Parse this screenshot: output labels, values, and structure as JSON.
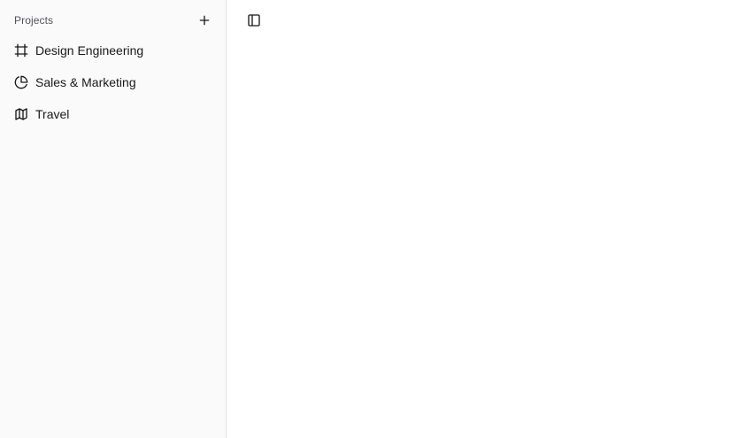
{
  "sidebar": {
    "group_label": "Projects",
    "add_icon": "plus-icon",
    "items": [
      {
        "label": "Design Engineering",
        "icon": "frame-icon"
      },
      {
        "label": "Sales & Marketing",
        "icon": "pie-chart-icon"
      },
      {
        "label": "Travel",
        "icon": "map-icon"
      }
    ]
  },
  "main": {
    "toggle_icon": "panel-left-icon"
  },
  "colors": {
    "sidebar_bg": "#fafafa",
    "border": "#e4e4e7",
    "text": "#18181b",
    "muted_text": "#52525b"
  }
}
